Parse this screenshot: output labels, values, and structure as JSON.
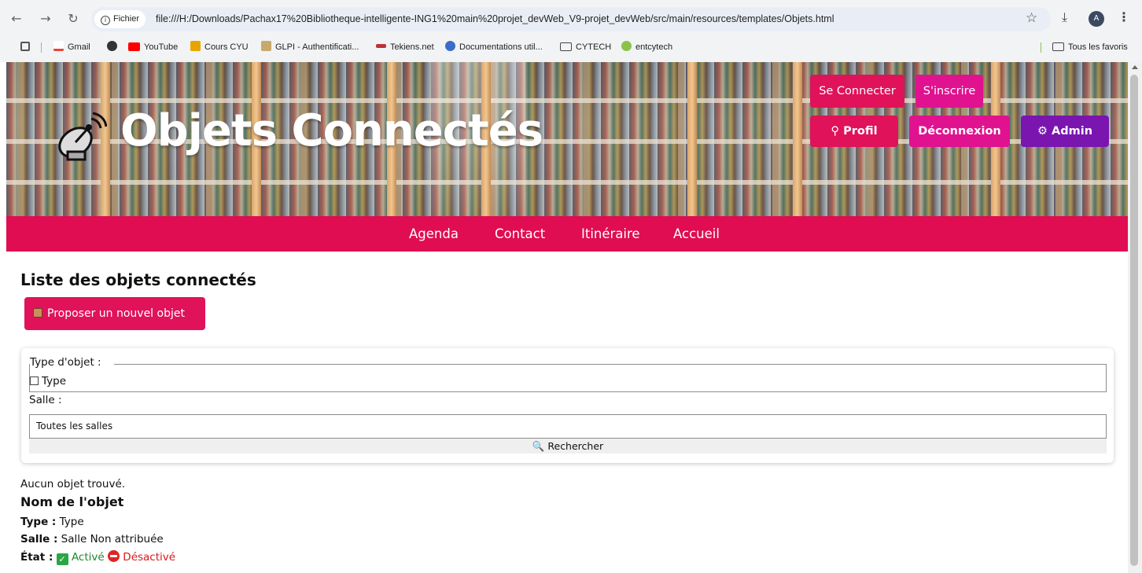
{
  "browser": {
    "site_chip": "Fichier",
    "url": "file:///H:/Downloads/Pachax17%20Bibliotheque-intelligente-ING1%20main%20projet_devWeb_V9-projet_devWeb/src/main/resources/templates/Objets.html",
    "avatar_letter": "A",
    "bookmarks": [
      "Gmail",
      "YouTube",
      "Cours CYU",
      "GLPI - Authentificati...",
      "Tekiens.net",
      "Documentations util...",
      "CYTECH",
      "entcytech"
    ],
    "all_bookmarks": "Tous les favoris"
  },
  "header": {
    "title": "Objets Connectés",
    "login": "Se Connecter",
    "signup": "S'inscrire",
    "profile": "Profil",
    "logout": "Déconnexion",
    "admin": "Admin"
  },
  "nav": [
    "Agenda",
    "Contact",
    "Itinéraire",
    "Accueil"
  ],
  "main": {
    "heading": "Liste des objets connectés",
    "propose_button": "Proposer un nouvel objet",
    "filter": {
      "type_legend": "Type d'objet :",
      "type_option": "Type",
      "salle_label": "Salle :",
      "salle_selected": "Toutes les salles",
      "search_button": "Rechercher"
    },
    "empty_message": "Aucun objet trouvé.",
    "object": {
      "name": "Nom de l'objet",
      "type_label": "Type :",
      "type_value": "Type",
      "salle_label": "Salle :",
      "salle_value": "Salle Non attribuée",
      "state_label": "État :",
      "state_on": "Activé",
      "state_off": "Désactivé"
    }
  },
  "colors": {
    "brand_pink": "#e00d52",
    "magenta": "#e0128f",
    "admin_purple": "#7a15b0"
  }
}
